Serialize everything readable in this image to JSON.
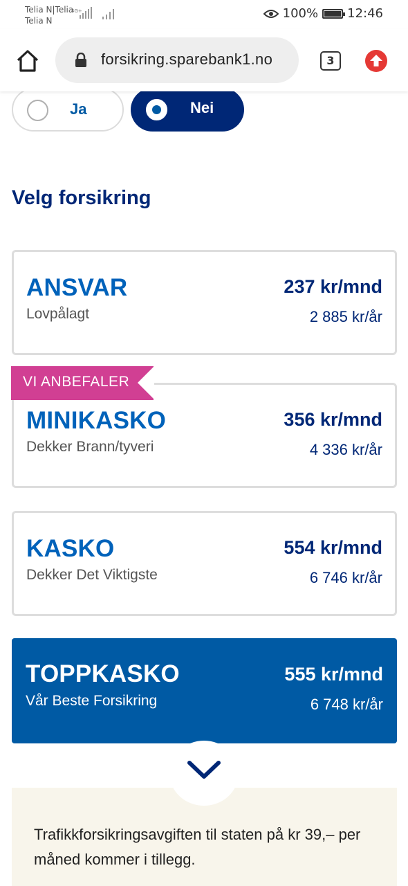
{
  "status_bar": {
    "carrier_line1": "Telia N|Telia",
    "carrier_line2": "Telia N",
    "network": "4G+",
    "battery": "100%",
    "time": "12:46"
  },
  "browser": {
    "url": "forsikring.sparebank1.no",
    "tab_count": "3"
  },
  "question": {
    "options": [
      {
        "label": "Ja",
        "selected": false
      },
      {
        "label": "Nei",
        "selected": true
      }
    ]
  },
  "section_title": "Velg forsikring",
  "recommendation_badge": "VI ANBEFALER",
  "insurance_options": [
    {
      "name": "ANSVAR",
      "description": "Lovpålagt",
      "price_month": "237 kr/mnd",
      "price_year": "2 885 kr/år",
      "selected": false
    },
    {
      "name": "MINIKASKO",
      "description": "Dekker Brann/tyveri",
      "price_month": "356 kr/mnd",
      "price_year": "4 336 kr/år",
      "selected": false,
      "recommended": true
    },
    {
      "name": "KASKO",
      "description": "Dekker Det Viktigste",
      "price_month": "554 kr/mnd",
      "price_year": "6 746 kr/år",
      "selected": false
    },
    {
      "name": "TOPPKASKO",
      "description": "Vår Beste Forsikring",
      "price_month": "555 kr/mnd",
      "price_year": "6 748 kr/år",
      "selected": true
    }
  ],
  "note": "Trafikkforsikringsavgiften til staten på kr 39,– per måned kommer i tillegg.",
  "colors": {
    "primary_dark": "#002776",
    "primary": "#005aa4",
    "accent_pink": "#d13f93",
    "note_bg": "#f8f5eb"
  }
}
